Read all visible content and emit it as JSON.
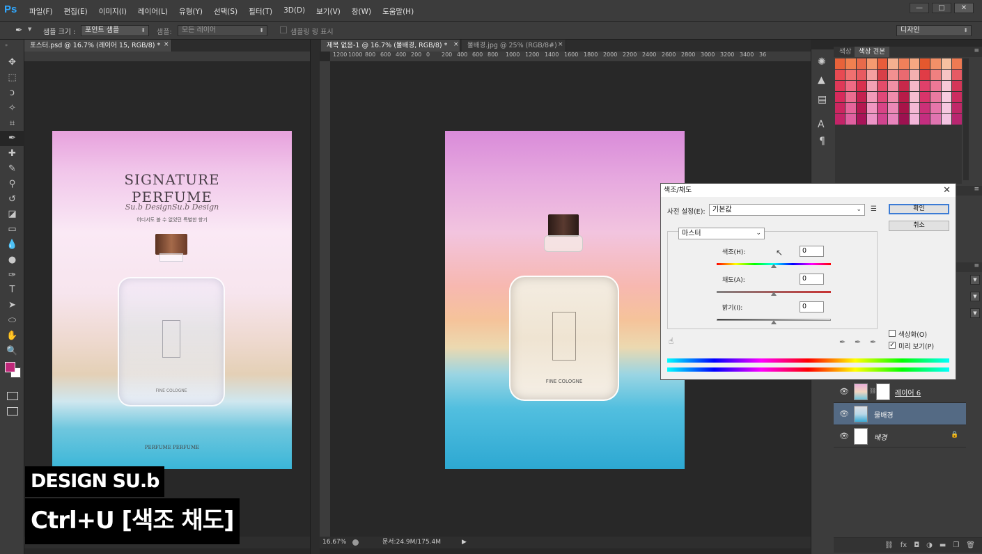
{
  "menubar": {
    "logo": "Ps",
    "items": [
      "파일(F)",
      "편집(E)",
      "이미지(I)",
      "레이어(L)",
      "유형(Y)",
      "선택(S)",
      "필터(T)",
      "3D(D)",
      "보기(V)",
      "창(W)",
      "도움말(H)"
    ],
    "window_buttons": [
      "—",
      "□",
      "✕"
    ]
  },
  "options": {
    "sample_size_label": "샘플 크기 :",
    "sample_size_value": "포인트 샘플",
    "sample_label": "샘플:",
    "sample_value": "모든 레이어",
    "show_ring": "샘플링 링 표시",
    "workspace": "디자인"
  },
  "tools": [
    "move",
    "marquee",
    "lasso",
    "magic-wand",
    "crop",
    "eyedropper",
    "healing",
    "brush",
    "stamp",
    "history-brush",
    "eraser",
    "gradient",
    "blur",
    "dodge",
    "pen",
    "type",
    "path-select",
    "shape",
    "hand",
    "zoom"
  ],
  "documents": [
    {
      "tab": "포스터.psd @ 16.7% (레이어 15, RGB/8) *",
      "zoom": "16.67%",
      "poster": {
        "title_line1": "SIGNATURE",
        "title_line2": "PERFUME",
        "script": "Su.b DesignSu.b Design",
        "subtitle": "어디서도 볼 수 없었던 특별한 향기",
        "bottle_label": "FINE COLOGNE",
        "footer": "PERFUME PERFUME"
      }
    },
    {
      "tab": "제목 없음-1 @ 16.7% (물배경, RGB/8) *",
      "zoom": "16.67%",
      "doc_status": "문서:24.9M/175.4M",
      "bottle_label": "FINE COLOGNE",
      "ruler_ticks": [
        "1200",
        "1000",
        "800",
        "600",
        "400",
        "200",
        "0",
        "200",
        "400",
        "600",
        "800",
        "1000",
        "1200",
        "1400",
        "1600",
        "1800",
        "2000",
        "2200",
        "2400",
        "2600",
        "2800",
        "3000",
        "3200",
        "3400",
        "36"
      ]
    },
    {
      "tab": "물배경.jpg @ 25% (RGB/8#)"
    }
  ],
  "swatches_panel": {
    "tabs": [
      "색상",
      "색상 견본"
    ],
    "colors": [
      "#e8623a",
      "#f08050",
      "#e86a4a",
      "#f59a70",
      "#e85c3a",
      "#f4b090",
      "#f0805a",
      "#f5a882",
      "#e4582e",
      "#f29068",
      "#f6c0a0",
      "#ee7a52",
      "#e84a52",
      "#f07070",
      "#e85a60",
      "#f5a0a0",
      "#d84048",
      "#f29090",
      "#ea6a70",
      "#f4b0b0",
      "#e03c46",
      "#f08080",
      "#f7c4c4",
      "#e65a64",
      "#e03858",
      "#f06a84",
      "#d8304e",
      "#f4a0b4",
      "#e44c6a",
      "#f290a6",
      "#c8284a",
      "#f6b8c8",
      "#e0406a",
      "#ee7896",
      "#f8c8d6",
      "#d43658",
      "#d82a5c",
      "#ec6c90",
      "#c42050",
      "#f29ab8",
      "#e04878",
      "#f08cac",
      "#b81c48",
      "#f6bcd0",
      "#d8346a",
      "#ea7aa0",
      "#f8cce0",
      "#cc2c60",
      "#cc2660",
      "#e6649a",
      "#b41850",
      "#f096c0",
      "#d84486",
      "#ec88b6",
      "#a81448",
      "#f4b8d4",
      "#cc3078",
      "#e676aa",
      "#f6c8e0",
      "#c02868",
      "#c42468",
      "#e060a0",
      "#a81458",
      "#ec94c6",
      "#d0448e",
      "#e884bc",
      "#9c1250",
      "#f2b4d8",
      "#c42e80",
      "#e074b0",
      "#f4c4e2",
      "#b82670"
    ]
  },
  "layers": [
    {
      "name": "레이어 6",
      "visible": true
    },
    {
      "name": "물배경",
      "visible": true,
      "selected": true
    },
    {
      "name": "배경",
      "visible": true,
      "locked": true
    }
  ],
  "hs_dialog": {
    "title": "색조/채도",
    "preset_label": "사전 설정(E):",
    "preset_value": "기본값",
    "ok": "확인",
    "cancel": "취소",
    "channel": "마스터",
    "hue_label": "색조(H):",
    "hue_value": "0",
    "hue_position": 0.5,
    "saturation_label": "채도(A):",
    "saturation_value": "0",
    "saturation_position": 0.5,
    "lightness_label": "밝기(I):",
    "lightness_value": "0",
    "lightness_position": 0.5,
    "colorize_label": "색상화(O)",
    "colorize_checked": false,
    "preview_label": "미리 보기(P)",
    "preview_checked": true
  },
  "watermark": {
    "brand": "DESIGN SU.b",
    "shortcut": "Ctrl+U [색조 채도]"
  }
}
